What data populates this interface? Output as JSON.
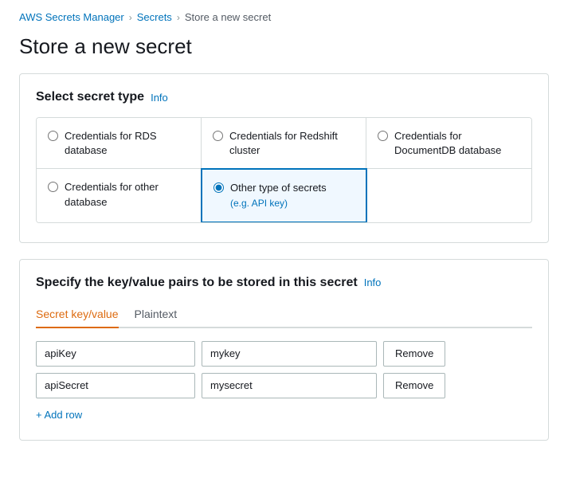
{
  "breadcrumb": {
    "items": [
      {
        "label": "AWS Secrets Manager",
        "href": "#"
      },
      {
        "label": "Secrets",
        "href": "#"
      },
      {
        "label": "Store a new secret"
      }
    ]
  },
  "page": {
    "title": "Store a new secret"
  },
  "secretTypeSection": {
    "title": "Select secret type",
    "info_label": "Info",
    "options": [
      {
        "id": "rds",
        "label": "Credentials for RDS database",
        "selected": false,
        "sub": ""
      },
      {
        "id": "redshift",
        "label": "Credentials for Redshift cluster",
        "selected": false,
        "sub": ""
      },
      {
        "id": "docdb",
        "label": "Credentials for DocumentDB database",
        "selected": false,
        "sub": ""
      },
      {
        "id": "other-db",
        "label": "Credentials for other database",
        "selected": false,
        "sub": ""
      },
      {
        "id": "other-type",
        "label": "Other type of secrets",
        "selected": true,
        "sub": "(e.g. API key)"
      }
    ]
  },
  "kvSection": {
    "title": "Specify the key/value pairs to be stored in this secret",
    "info_label": "Info",
    "tabs": [
      {
        "id": "kv",
        "label": "Secret key/value",
        "active": true
      },
      {
        "id": "plaintext",
        "label": "Plaintext",
        "active": false
      }
    ],
    "rows": [
      {
        "key": "apiKey",
        "value": "mykey"
      },
      {
        "key": "apiSecret",
        "value": "mysecret"
      }
    ],
    "add_row_label": "+ Add row",
    "remove_label": "Remove"
  }
}
